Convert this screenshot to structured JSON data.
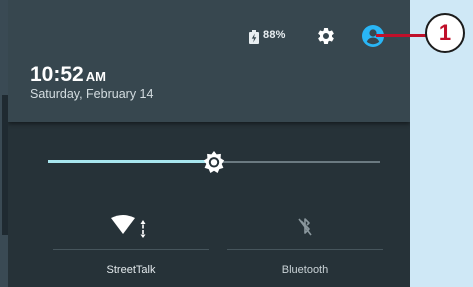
{
  "status": {
    "battery_text": "88%",
    "battery_level": 0.88
  },
  "clock": {
    "time": "10:52",
    "ampm": "AM",
    "date": "Saturday, February 14"
  },
  "brightness": {
    "level": 0.5
  },
  "tiles": [
    {
      "label": "StreetTalk",
      "icon": "wifi-icon",
      "state": "on"
    },
    {
      "label": "Bluetooth",
      "icon": "bluetooth-off-icon",
      "state": "off"
    }
  ],
  "callout": {
    "number": "1"
  },
  "colors": {
    "panel": "#263238",
    "header": "#37474f",
    "slider_accent": "#a8e6ef",
    "account_icon": "#29b6f6",
    "callout": "#c0102a"
  }
}
